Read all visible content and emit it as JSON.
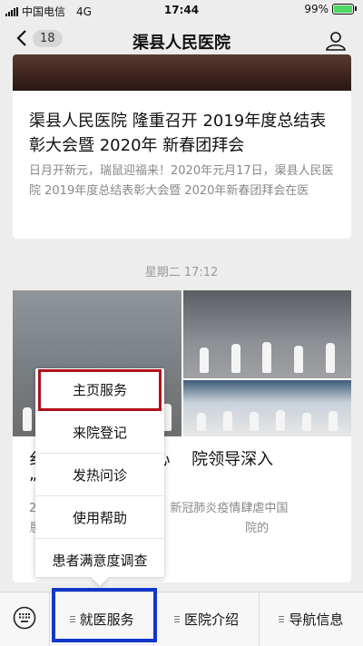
{
  "status": {
    "carrier": "中国电信",
    "network": "4G",
    "time": "17:44",
    "battery": "99%"
  },
  "nav": {
    "back_count": "18",
    "title": "渠县人民医院"
  },
  "article1": {
    "title": "渠县人民医院 隆重召开 2019年度总结表彰大会暨 2020年 新春团拜会",
    "desc": "日月开新元，瑞鼠迎福来！2020年元月17日，渠县人民医院 2019年度总结表彰大会暨 2020年新春团拜会在医"
  },
  "timestamp": "星期二 17:12",
  "article2": {
    "title": "纟  　　　 邃护士心　 院领导深入　　　 ”护士节慰问活动",
    "desc": "2　　　　　　　　 一年，新冠肺炎疫情肆虐中国　　　　　　　 恳听从习近平总书记的指　　　　　　　 院的"
  },
  "popup": {
    "items": [
      "主页服务",
      "来院登记",
      "发热问诊",
      "使用帮助",
      "患者满意度调查"
    ]
  },
  "bottom": {
    "tabs": [
      "就医服务",
      "医院介绍",
      "导航信息"
    ]
  },
  "icons": {
    "back": "chevron-left-icon",
    "profile": "person-icon",
    "keyboard": "keyboard-icon",
    "menu": "menu-lines-icon"
  }
}
